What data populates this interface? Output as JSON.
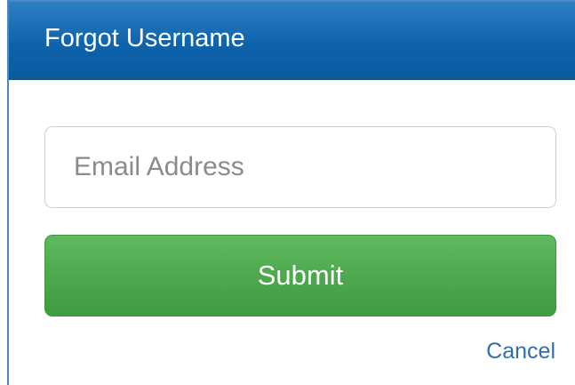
{
  "dialog": {
    "title": "Forgot Username",
    "header_color": "#0e63ab"
  },
  "form": {
    "email_placeholder": "Email Address",
    "email_value": "",
    "submit_label": "Submit",
    "submit_color": "#4ea94e",
    "cancel_label": "Cancel",
    "cancel_color": "#2e6fae"
  }
}
